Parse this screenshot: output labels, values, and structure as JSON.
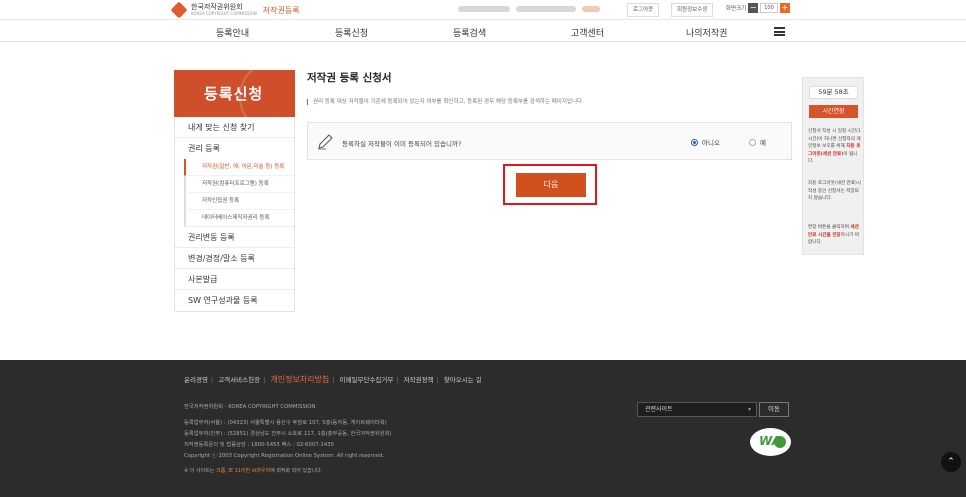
{
  "header": {
    "logo_name": "한국저작권위원회",
    "logo_name_en": "KOREA COPYRIGHT COMMISSION",
    "logo_sub": "저작권등록",
    "buttons": {
      "logout": "로그아웃",
      "account": "회원정보수정",
      "zoom_label": "화면크기"
    },
    "zoom_value": "100"
  },
  "gnb": [
    "등록안내",
    "등록신청",
    "등록검색",
    "고객센터",
    "나의저작권"
  ],
  "sidebar": {
    "title": "등록신청",
    "items": [
      {
        "label": "내게 맞는 신청 찾기"
      },
      {
        "label": "권리 등록"
      },
      {
        "label": "저작권(일반, 예: 어문,미술 등) 등록",
        "sub": true,
        "active": true
      },
      {
        "label": "저작권(컴퓨터프로그램) 등록",
        "sub": true
      },
      {
        "label": "저작인접권 등록",
        "sub": true
      },
      {
        "label": "데이터베이스제작자권리 등록",
        "sub": true
      },
      {
        "label": "권리변동 등록"
      },
      {
        "label": "변경/경정/말소 등록"
      },
      {
        "label": "사본발급"
      },
      {
        "label": "SW 연구성과물 등록"
      }
    ]
  },
  "main": {
    "title": "저작권 등록 신청서",
    "description": "권리 등록 대상 저작물이 기존에 등록되어 있는지 여부를 확인하고, 등록된 경우 해당 등록부를 검색하는 페이지입니다.",
    "question": "등록하실 저작물이 이미 등록되어 있습니까?",
    "options": {
      "no": "아니오",
      "yes": "예"
    },
    "selected": "no",
    "next_label": "다음"
  },
  "timer": {
    "value": "59분 58초",
    "extend_label": "시간연장",
    "note1_a": "신청서 작성 시 일정 시간(1시간)이 지나면 신청자의 개인정보 보호를 위해 ",
    "note1_b": "자동 로그아웃(세션 만료)",
    "note1_c": "이 됩니다.",
    "note2": "자동 로그아웃(세션 만료)시 작성 중인 신청서는 저장되지 않습니다.",
    "note3_a": "연장 버튼을 클릭하여 ",
    "note3_b": "세션 만료 시간을 연장",
    "note3_c": "하시기 바랍니다."
  },
  "footer": {
    "links": [
      "윤리경영",
      "고객서비스헌장",
      "개인정보처리방침",
      "이메일무단수집거부",
      "저작권정책",
      "찾아오시는 길"
    ],
    "org": "한국저작권위원회 - KOREA COPYRIGHT COMMISSION",
    "addr1": "등록업무처(서울) : (04323) 서울특별시 용산구 후암로 107, 5층(동자동, 게이트웨이타워)",
    "addr2": "등록업무처(진주) : (52851) 경상남도 진주시 소호로 117, 1층(충무공동, 한국저작권위원회)",
    "contact": "저작권등록문의 및 법률상담 : 1800-5455    팩스 : 02-6007-1435",
    "copyright": "Copyright ⓒ 2003 Copyright Registration Online System. All right reserved.",
    "note_a": "※ 이 사이트는 ",
    "note_em": "크롬, IE 11이번 브라우저",
    "note_b": "에 최적화 되어 있습니다.",
    "related_site": "관련사이트",
    "go_label": "이동",
    "wa_label": "WA"
  }
}
